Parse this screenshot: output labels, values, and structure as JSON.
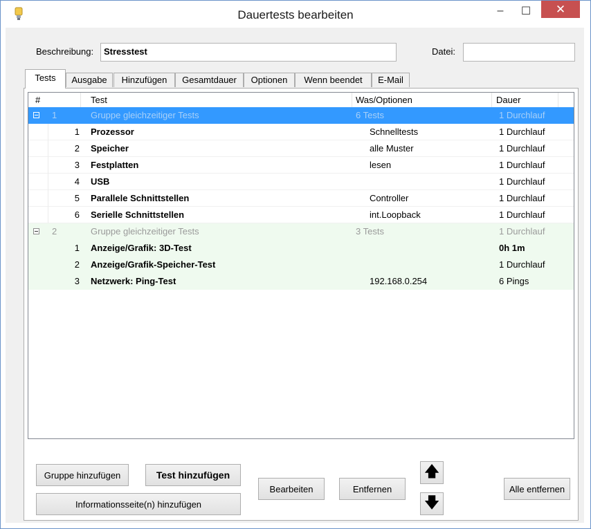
{
  "window": {
    "title": "Dauertests bearbeiten",
    "minimize_glyph": "–",
    "maximize_glyph": "☐",
    "close_glyph": "✕",
    "icon": "app-icon"
  },
  "form": {
    "beschreibung_label": "Beschreibung:",
    "beschreibung_value": "Stresstest",
    "datei_label": "Datei:",
    "datei_value": ""
  },
  "tabs": [
    {
      "label": "Tests",
      "active": true
    },
    {
      "label": "Ausgabe"
    },
    {
      "label": "Hinzufügen"
    },
    {
      "label": "Gesamtdauer"
    },
    {
      "label": "Optionen"
    },
    {
      "label": "Wenn beendet"
    },
    {
      "label": "E-Mail"
    }
  ],
  "list": {
    "headers": {
      "num": "#",
      "test": "Test",
      "options": "Was/Optionen",
      "duration": "Dauer"
    },
    "groups": [
      {
        "num": "1",
        "name": "Gruppe gleichzeitiger Tests",
        "options": "6 Tests",
        "duration": "1 Durchlauf",
        "items": [
          {
            "num": "1",
            "test": "Prozessor",
            "options": "Schnelltests",
            "duration": "1 Durchlauf"
          },
          {
            "num": "2",
            "test": "Speicher",
            "options": "alle Muster",
            "duration": "1 Durchlauf"
          },
          {
            "num": "3",
            "test": "Festplatten",
            "options": "lesen",
            "duration": "1 Durchlauf"
          },
          {
            "num": "4",
            "test": "USB",
            "options": "",
            "duration": "1 Durchlauf"
          },
          {
            "num": "5",
            "test": "Parallele Schnittstellen",
            "options": "Controller",
            "duration": "1 Durchlauf"
          },
          {
            "num": "6",
            "test": "Serielle Schnittstellen",
            "options": "int.Loopback",
            "duration": "1 Durchlauf"
          }
        ]
      },
      {
        "num": "2",
        "name": "Gruppe gleichzeitiger Tests",
        "options": "3 Tests",
        "duration": "1 Durchlauf",
        "items": [
          {
            "num": "1",
            "test": "Anzeige/Grafik: 3D-Test",
            "options": "",
            "duration": "0h 1m"
          },
          {
            "num": "2",
            "test": "Anzeige/Grafik-Speicher-Test",
            "options": "",
            "duration": "1 Durchlauf"
          },
          {
            "num": "3",
            "test": "Netzwerk: Ping-Test",
            "options": "192.168.0.254",
            "duration": "6 Pings"
          }
        ]
      }
    ]
  },
  "buttons": {
    "gruppe_hinzufuegen": "Gruppe hinzufügen",
    "test_hinzufuegen": "Test hinzufügen",
    "info_hinzufuegen": "Informationsseite(n) hinzufügen",
    "bearbeiten": "Bearbeiten",
    "entfernen": "Entfernen",
    "up_glyph": "🡅",
    "down_glyph": "🡇",
    "alle_entfernen": "Alle entfernen"
  },
  "colors": {
    "selection": "#3399ff",
    "group2_background": "#effaef",
    "close_button": "#c75050"
  }
}
